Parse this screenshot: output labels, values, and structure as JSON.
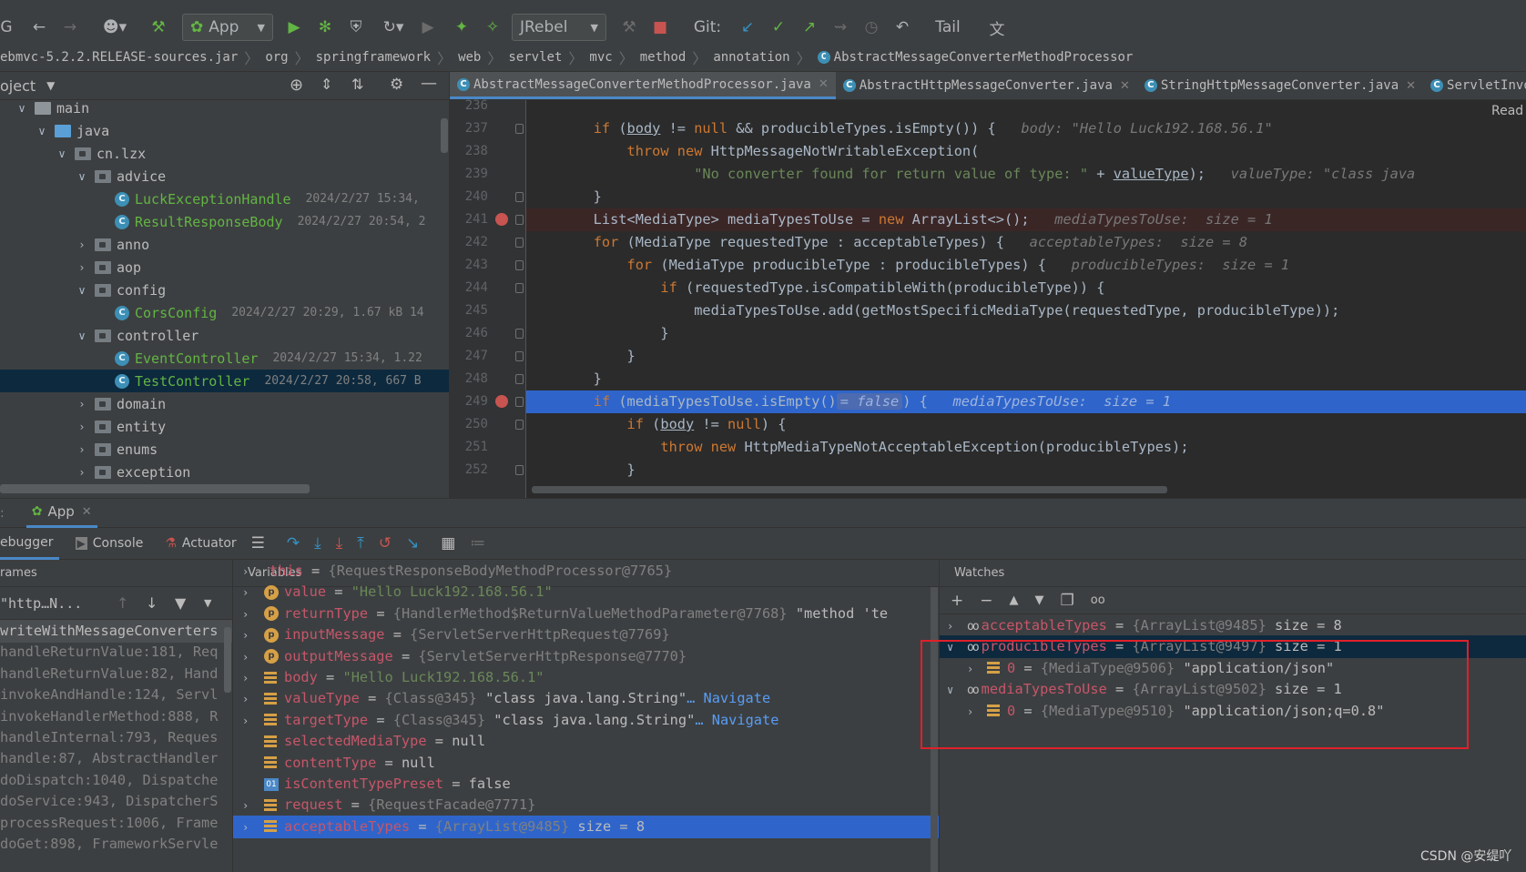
{
  "toolbar": {
    "run_config": "App",
    "jrebel": "JRebel",
    "git_label": "Git:",
    "tail": "Tail"
  },
  "breadcrumb": [
    "ebmvc-5.2.2.RELEASE-sources.jar",
    "org",
    "springframework",
    "web",
    "servlet",
    "mvc",
    "method",
    "annotation",
    "AbstractMessageConverterMethodProcessor"
  ],
  "project": {
    "title": "oject",
    "tree": [
      {
        "label": "main",
        "type": "folder"
      },
      {
        "label": "java",
        "type": "folder-blue"
      },
      {
        "label": "cn.lzx",
        "type": "package"
      },
      {
        "label": "advice",
        "type": "package"
      },
      {
        "label": "LuckExceptionHandle",
        "type": "class",
        "meta": "2024/2/27 15:34,"
      },
      {
        "label": "ResultResponseBody",
        "type": "class",
        "meta": "2024/2/27 20:54, 2"
      },
      {
        "label": "anno",
        "type": "package"
      },
      {
        "label": "aop",
        "type": "package"
      },
      {
        "label": "config",
        "type": "package"
      },
      {
        "label": "CorsConfig",
        "type": "class",
        "meta": "2024/2/27 20:29, 1.67 kB 14"
      },
      {
        "label": "controller",
        "type": "package"
      },
      {
        "label": "EventController",
        "type": "class",
        "meta": "2024/2/27 15:34, 1.22"
      },
      {
        "label": "TestController",
        "type": "class",
        "meta": "2024/2/27 20:58, 667 B"
      },
      {
        "label": "domain",
        "type": "package"
      },
      {
        "label": "entity",
        "type": "package"
      },
      {
        "label": "enums",
        "type": "package"
      },
      {
        "label": "exception",
        "type": "package"
      }
    ]
  },
  "editor": {
    "tabs": [
      "AbstractMessageConverterMethodProcessor.java",
      "AbstractHttpMessageConverter.java",
      "StringHttpMessageConverter.java",
      "ServletInvocab"
    ],
    "reader_mode": "Read",
    "line_numbers": [
      "236",
      "237",
      "238",
      "239",
      "240",
      "241",
      "242",
      "243",
      "244",
      "245",
      "246",
      "247",
      "248",
      "249",
      "250",
      "251",
      "252"
    ],
    "hints": {
      "l237": "body: \"Hello Luck192.168.56.1\"",
      "l239": "valueType: \"class java",
      "l241": "mediaTypesToUse:  size = 1",
      "l242": "acceptableTypes:  size = 8",
      "l243": "producibleTypes:  size = 1",
      "l249_inline": "= false",
      "l249": "mediaTypesToUse:  size = 1"
    }
  },
  "debug": {
    "session_tab": "App",
    "tabs": [
      "ebugger",
      "Console",
      "Actuator"
    ],
    "frames_title": "rames",
    "thread": "\"http…N...",
    "frames": [
      "writeWithMessageConverters",
      "handleReturnValue:181, Req",
      "handleReturnValue:82, Hand",
      "invokeAndHandle:124, Servl",
      "invokeHandlerMethod:888, R",
      "handleInternal:793, Reques",
      "handle:87, AbstractHandler",
      "doDispatch:1040, Dispatche",
      "doService:943, DispatcherS",
      "processRequest:1006, Frame",
      "doGet:898, FrameworkServle"
    ],
    "variables_title": "Variables",
    "variables": [
      {
        "badge": "none",
        "name": "this",
        "type": "{RequestResponseBodyMethodProcessor@7765}",
        "value": "",
        "nav": ""
      },
      {
        "badge": "p",
        "name": "value",
        "type": "",
        "value": "\"Hello Luck192.168.56.1\"",
        "nav": ""
      },
      {
        "badge": "p",
        "name": "returnType",
        "type": "{HandlerMethod$ReturnValueMethodParameter@7768}",
        "value": "\"method 'te",
        "nav": ""
      },
      {
        "badge": "p",
        "name": "inputMessage",
        "type": "{ServletServerHttpRequest@7769}",
        "value": "",
        "nav": ""
      },
      {
        "badge": "p",
        "name": "outputMessage",
        "type": "{ServletServerHttpResponse@7770}",
        "value": "",
        "nav": ""
      },
      {
        "badge": "field",
        "name": "body",
        "type": "",
        "value": "\"Hello Luck192.168.56.1\"",
        "nav": ""
      },
      {
        "badge": "field",
        "name": "valueType",
        "type": "{Class@345}",
        "value": "\"class java.lang.String\"",
        "nav": "… Navigate"
      },
      {
        "badge": "field",
        "name": "targetType",
        "type": "{Class@345}",
        "value": "\"class java.lang.String\"",
        "nav": "… Navigate"
      },
      {
        "badge": "field",
        "name": "selectedMediaType",
        "type": "",
        "value": "null",
        "nav": ""
      },
      {
        "badge": "field",
        "name": "contentType",
        "type": "",
        "value": "null",
        "nav": ""
      },
      {
        "badge": "01",
        "name": "isContentTypePreset",
        "type": "",
        "value": "false",
        "nav": ""
      },
      {
        "badge": "field",
        "name": "request",
        "type": "{RequestFacade@7771}",
        "value": "",
        "nav": ""
      },
      {
        "badge": "field",
        "name": "acceptableTypes",
        "type": "{ArrayList@9485}",
        "value": "size = 8",
        "nav": ""
      }
    ],
    "watches_title": "Watches",
    "watches": [
      {
        "level": 0,
        "expanded": false,
        "name": "acceptableTypes",
        "type": "{ArrayList@9485}",
        "value": "size = 8"
      },
      {
        "level": 0,
        "expanded": true,
        "name": "producibleTypes",
        "type": "{ArrayList@9497}",
        "value": "size = 1"
      },
      {
        "level": 1,
        "expanded": false,
        "name": "0",
        "type": "{MediaType@9506}",
        "value": "\"application/json\""
      },
      {
        "level": 0,
        "expanded": true,
        "name": "mediaTypesToUse",
        "type": "{ArrayList@9502}",
        "value": "size = 1"
      },
      {
        "level": 1,
        "expanded": false,
        "name": "0",
        "type": "{MediaType@9510}",
        "value": "\"application/json;q=0.8\""
      }
    ]
  },
  "watermark": "CSDN @安缇吖",
  "colors": {
    "highlight_box": "#e0202a",
    "selection": "#2f65ca",
    "breakpoint": "#c75450"
  }
}
